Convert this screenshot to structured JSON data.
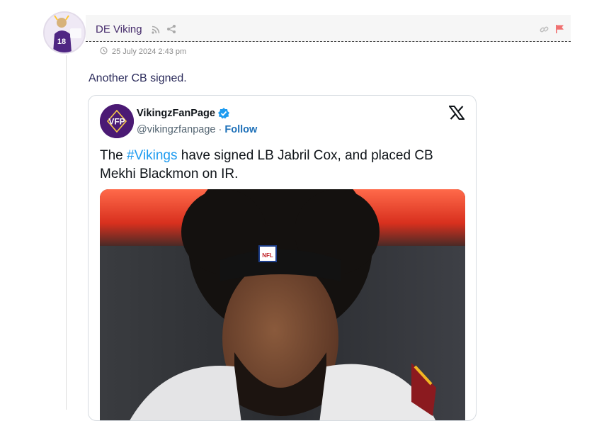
{
  "post": {
    "author": "DE Viking",
    "date": "25 July 2024 2:43 pm",
    "text": "Another CB signed.",
    "avatar_label": "18"
  },
  "icons": {
    "rss": "rss-icon",
    "share": "share-icon",
    "link": "link-icon",
    "flag": "flag-icon",
    "clock": "clock-icon"
  },
  "tweet": {
    "display_name": "VikingzFanPage",
    "handle": "@vikingzfanpage",
    "separator": "·",
    "follow_label": "Follow",
    "avatar_text": "VFP",
    "text_before": "The ",
    "hashtag": "#Vikings",
    "text_after": " have signed LB Jabril Cox, and placed CB Mekhi Blackmon on IR.",
    "media_logo_text": "NFL"
  },
  "colors": {
    "accent": "#452b6b",
    "flag": "#f07070",
    "link_blue": "#1d9bf0",
    "follow_blue": "#1d70b8",
    "verified": "#1d9bf0"
  }
}
